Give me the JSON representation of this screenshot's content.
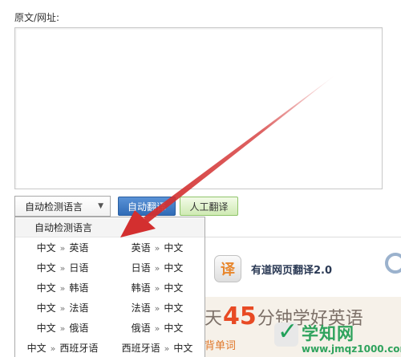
{
  "form": {
    "source_label": "原文/网址:",
    "source_text": "",
    "lang_select_value": "自动检测语言",
    "auto_translate_label": "自动翻译",
    "human_translate_label": "人工翻译"
  },
  "dropdown": {
    "auto_option": "自动检测语言",
    "separator": "»",
    "rows": [
      {
        "left": {
          "from": "中文",
          "to": "英语"
        },
        "right": {
          "from": "英语",
          "to": "中文"
        }
      },
      {
        "left": {
          "from": "中文",
          "to": "日语"
        },
        "right": {
          "from": "日语",
          "to": "中文"
        }
      },
      {
        "left": {
          "from": "中文",
          "to": "韩语"
        },
        "right": {
          "from": "韩语",
          "to": "中文"
        }
      },
      {
        "left": {
          "from": "中文",
          "to": "法语"
        },
        "right": {
          "from": "法语",
          "to": "中文"
        }
      },
      {
        "left": {
          "from": "中文",
          "to": "俄语"
        },
        "right": {
          "from": "俄语",
          "to": "中文"
        }
      },
      {
        "left": {
          "from": "中文",
          "to": "西班牙语"
        },
        "right": {
          "from": "西班牙语",
          "to": "中文"
        }
      }
    ]
  },
  "banner": {
    "logo_glyph": "译",
    "title": "有道网页翻译2.0",
    "promo_prefix": "天",
    "promo_number": "45",
    "promo_suffix": "分钟学好英语",
    "promo_sub": "背单词"
  },
  "watermark": {
    "title": "学知网",
    "url": "www.jmqz1000.com"
  },
  "colors": {
    "annotation_arrow": "#d32f2f",
    "auto_button": "#3a78c4",
    "human_button": "#d8f0c0",
    "watermark_green": "#2fa35d"
  },
  "icons": [
    "dropdown-caret-icon",
    "youdao-logo-icon",
    "magnifier-icon",
    "watermark-check-icon",
    "annotation-arrow"
  ]
}
